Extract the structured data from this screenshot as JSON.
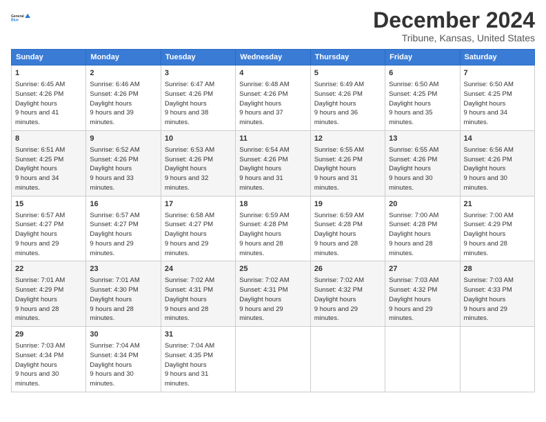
{
  "header": {
    "logo_line1": "General",
    "logo_line2": "Blue",
    "title": "December 2024",
    "subtitle": "Tribune, Kansas, United States"
  },
  "days_of_week": [
    "Sunday",
    "Monday",
    "Tuesday",
    "Wednesday",
    "Thursday",
    "Friday",
    "Saturday"
  ],
  "weeks": [
    [
      {
        "day": "1",
        "sunrise": "6:45 AM",
        "sunset": "4:26 PM",
        "daylight": "9 hours and 41 minutes."
      },
      {
        "day": "2",
        "sunrise": "6:46 AM",
        "sunset": "4:26 PM",
        "daylight": "9 hours and 39 minutes."
      },
      {
        "day": "3",
        "sunrise": "6:47 AM",
        "sunset": "4:26 PM",
        "daylight": "9 hours and 38 minutes."
      },
      {
        "day": "4",
        "sunrise": "6:48 AM",
        "sunset": "4:26 PM",
        "daylight": "9 hours and 37 minutes."
      },
      {
        "day": "5",
        "sunrise": "6:49 AM",
        "sunset": "4:26 PM",
        "daylight": "9 hours and 36 minutes."
      },
      {
        "day": "6",
        "sunrise": "6:50 AM",
        "sunset": "4:25 PM",
        "daylight": "9 hours and 35 minutes."
      },
      {
        "day": "7",
        "sunrise": "6:50 AM",
        "sunset": "4:25 PM",
        "daylight": "9 hours and 34 minutes."
      }
    ],
    [
      {
        "day": "8",
        "sunrise": "6:51 AM",
        "sunset": "4:25 PM",
        "daylight": "9 hours and 34 minutes."
      },
      {
        "day": "9",
        "sunrise": "6:52 AM",
        "sunset": "4:26 PM",
        "daylight": "9 hours and 33 minutes."
      },
      {
        "day": "10",
        "sunrise": "6:53 AM",
        "sunset": "4:26 PM",
        "daylight": "9 hours and 32 minutes."
      },
      {
        "day": "11",
        "sunrise": "6:54 AM",
        "sunset": "4:26 PM",
        "daylight": "9 hours and 31 minutes."
      },
      {
        "day": "12",
        "sunrise": "6:55 AM",
        "sunset": "4:26 PM",
        "daylight": "9 hours and 31 minutes."
      },
      {
        "day": "13",
        "sunrise": "6:55 AM",
        "sunset": "4:26 PM",
        "daylight": "9 hours and 30 minutes."
      },
      {
        "day": "14",
        "sunrise": "6:56 AM",
        "sunset": "4:26 PM",
        "daylight": "9 hours and 30 minutes."
      }
    ],
    [
      {
        "day": "15",
        "sunrise": "6:57 AM",
        "sunset": "4:27 PM",
        "daylight": "9 hours and 29 minutes."
      },
      {
        "day": "16",
        "sunrise": "6:57 AM",
        "sunset": "4:27 PM",
        "daylight": "9 hours and 29 minutes."
      },
      {
        "day": "17",
        "sunrise": "6:58 AM",
        "sunset": "4:27 PM",
        "daylight": "9 hours and 29 minutes."
      },
      {
        "day": "18",
        "sunrise": "6:59 AM",
        "sunset": "4:28 PM",
        "daylight": "9 hours and 28 minutes."
      },
      {
        "day": "19",
        "sunrise": "6:59 AM",
        "sunset": "4:28 PM",
        "daylight": "9 hours and 28 minutes."
      },
      {
        "day": "20",
        "sunrise": "7:00 AM",
        "sunset": "4:28 PM",
        "daylight": "9 hours and 28 minutes."
      },
      {
        "day": "21",
        "sunrise": "7:00 AM",
        "sunset": "4:29 PM",
        "daylight": "9 hours and 28 minutes."
      }
    ],
    [
      {
        "day": "22",
        "sunrise": "7:01 AM",
        "sunset": "4:29 PM",
        "daylight": "9 hours and 28 minutes."
      },
      {
        "day": "23",
        "sunrise": "7:01 AM",
        "sunset": "4:30 PM",
        "daylight": "9 hours and 28 minutes."
      },
      {
        "day": "24",
        "sunrise": "7:02 AM",
        "sunset": "4:31 PM",
        "daylight": "9 hours and 28 minutes."
      },
      {
        "day": "25",
        "sunrise": "7:02 AM",
        "sunset": "4:31 PM",
        "daylight": "9 hours and 29 minutes."
      },
      {
        "day": "26",
        "sunrise": "7:02 AM",
        "sunset": "4:32 PM",
        "daylight": "9 hours and 29 minutes."
      },
      {
        "day": "27",
        "sunrise": "7:03 AM",
        "sunset": "4:32 PM",
        "daylight": "9 hours and 29 minutes."
      },
      {
        "day": "28",
        "sunrise": "7:03 AM",
        "sunset": "4:33 PM",
        "daylight": "9 hours and 29 minutes."
      }
    ],
    [
      {
        "day": "29",
        "sunrise": "7:03 AM",
        "sunset": "4:34 PM",
        "daylight": "9 hours and 30 minutes."
      },
      {
        "day": "30",
        "sunrise": "7:04 AM",
        "sunset": "4:34 PM",
        "daylight": "9 hours and 30 minutes."
      },
      {
        "day": "31",
        "sunrise": "7:04 AM",
        "sunset": "4:35 PM",
        "daylight": "9 hours and 31 minutes."
      },
      null,
      null,
      null,
      null
    ]
  ],
  "labels": {
    "sunrise": "Sunrise:",
    "sunset": "Sunset:",
    "daylight": "Daylight hours"
  }
}
